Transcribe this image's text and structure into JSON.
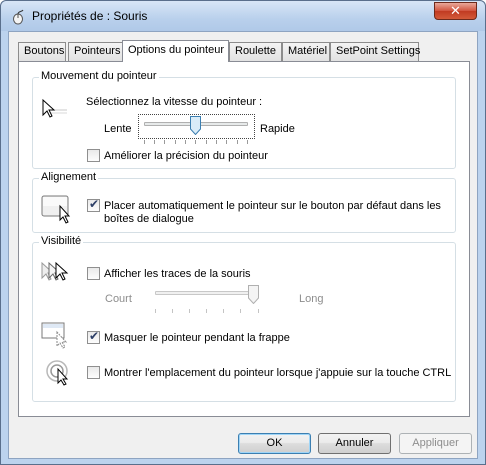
{
  "window": {
    "title": "Propriétés de : Souris",
    "close_label": "✕"
  },
  "tabs": [
    {
      "label": "Boutons",
      "active": false
    },
    {
      "label": "Pointeurs",
      "active": false
    },
    {
      "label": "Options du pointeur",
      "active": true
    },
    {
      "label": "Roulette",
      "active": false
    },
    {
      "label": "Matériel",
      "active": false
    },
    {
      "label": "SetPoint Settings",
      "active": false
    }
  ],
  "motion": {
    "title": "Mouvement du pointeur",
    "speed_label": "Sélectionnez la vitesse du pointeur :",
    "slow_label": "Lente",
    "fast_label": "Rapide",
    "speed_value": 0.5,
    "precision_label": "Améliorer la précision du pointeur",
    "precision_checked": false
  },
  "snap": {
    "title": "Alignement",
    "snap_label_line1": "Placer automatiquement le pointeur sur le bouton par défaut dans les",
    "snap_label_line2": "boîtes de dialogue",
    "snap_checked": true
  },
  "visibility": {
    "title": "Visibilité",
    "trails_label": "Afficher les traces de la souris",
    "trails_checked": false,
    "short_label": "Court",
    "long_label": "Long",
    "trails_value": 1.0,
    "hide_label": "Masquer le pointeur pendant la frappe",
    "hide_checked": true,
    "ctrl_label": "Montrer l'emplacement du pointeur lorsque j'appuie sur la touche CTRL",
    "ctrl_checked": false
  },
  "buttons": {
    "ok": "OK",
    "cancel": "Annuler",
    "apply": "Appliquer"
  }
}
